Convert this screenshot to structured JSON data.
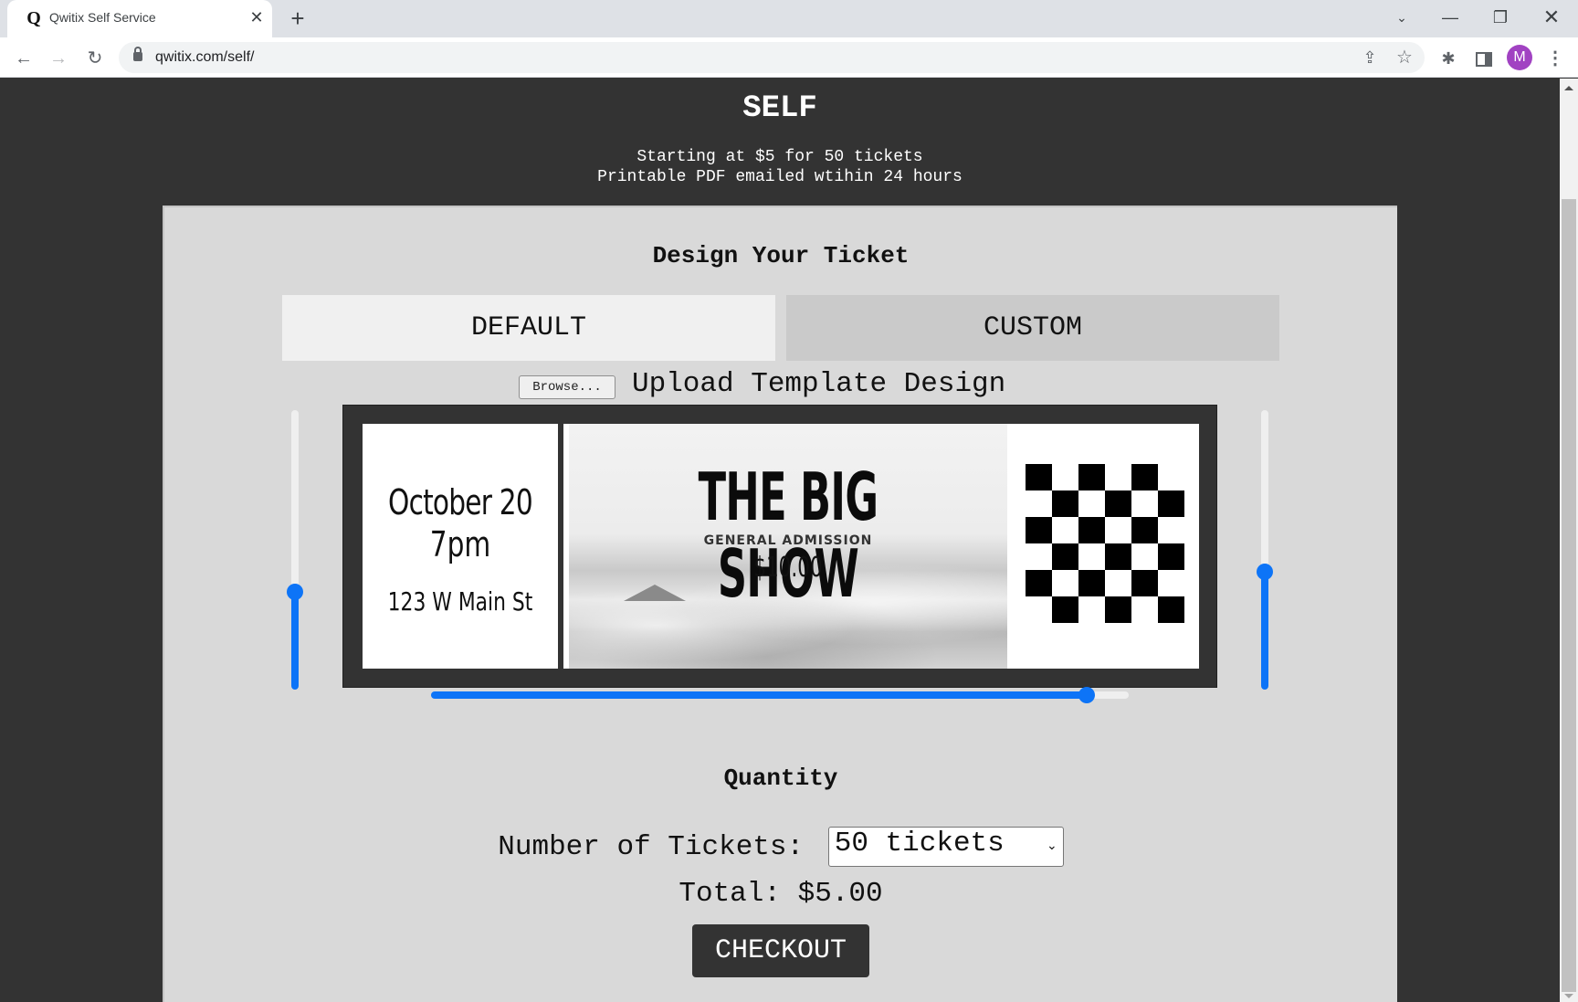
{
  "browser": {
    "tab_title": "Qwitix Self Service",
    "favicon": "Q",
    "url": "qwitix.com/self/",
    "profile_initial": "M",
    "icons": {
      "back": "arrow-left-icon",
      "forward": "arrow-right-icon",
      "reload": "reload-icon",
      "lock": "lock-icon",
      "share": "share-icon",
      "bookmark": "star-icon",
      "extensions": "puzzle-icon",
      "side_panel": "side-panel-icon",
      "menu": "kebab-menu-icon",
      "tab_search": "chevron-down-icon",
      "minimize": "minimize-icon",
      "restore": "restore-icon",
      "close": "close-icon"
    },
    "glyphs": {
      "tab_close": "✕",
      "new_tab": "+",
      "back": "←",
      "forward": "→",
      "reload": "↻",
      "share": "⇪",
      "star": "☆",
      "ext": "✱",
      "menu": "⋮",
      "tab_search": "⌄",
      "minimize": "—",
      "restore": "❐",
      "close": "✕"
    }
  },
  "header": {
    "title": "SELF",
    "tagline_1": "Starting at $5 for 50 tickets",
    "tagline_2": "Printable PDF emailed wtihin 24 hours"
  },
  "design": {
    "title": "Design Your Ticket",
    "tabs": [
      {
        "label": "DEFAULT",
        "active": true
      },
      {
        "label": "CUSTOM",
        "active": false
      }
    ],
    "browse_label": "Browse...",
    "upload_label": "Upload Template Design",
    "sliders": {
      "left_vertical_percent": 35,
      "right_vertical_percent": 42,
      "horizontal_percent": 94
    },
    "accent_color": "#0d74f7"
  },
  "ticket": {
    "date": "October 20",
    "time": "7pm",
    "address": "123 W Main St",
    "show_title": "THE BIG SHOW",
    "admission": "GENERAL ADMISSION",
    "price": "$10.00",
    "code_pattern": [
      [
        1,
        0,
        1,
        0,
        1,
        0
      ],
      [
        0,
        1,
        0,
        1,
        0,
        1
      ],
      [
        1,
        0,
        1,
        0,
        1,
        0
      ],
      [
        0,
        1,
        0,
        1,
        0,
        1
      ],
      [
        1,
        0,
        1,
        0,
        1,
        0
      ],
      [
        0,
        1,
        0,
        1,
        0,
        1
      ]
    ]
  },
  "quantity": {
    "title": "Quantity",
    "label": "Number of Tickets:",
    "selected": "50 tickets",
    "total": "Total: $5.00",
    "checkout_label": "CHECKOUT"
  }
}
